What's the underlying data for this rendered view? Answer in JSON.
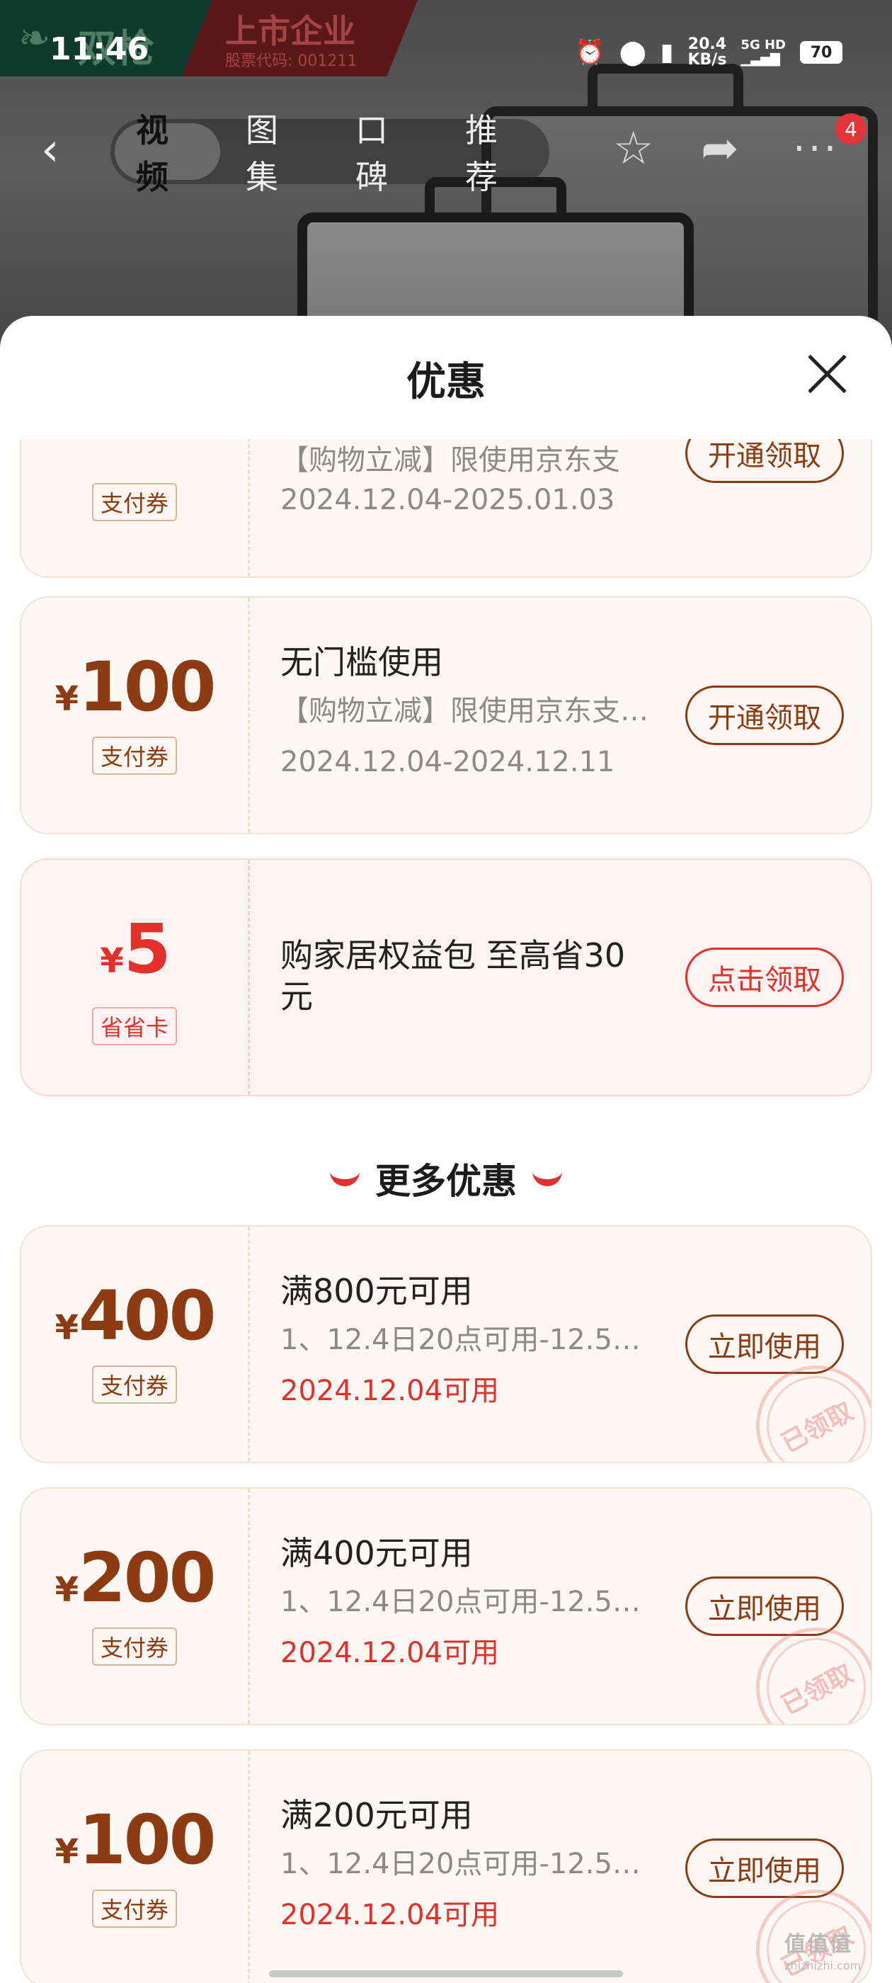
{
  "status_bar": {
    "time": "11:46",
    "speed_value": "20.4",
    "speed_unit": "KB/s",
    "network_type": "5G HD",
    "battery": "70"
  },
  "brand_banner": {
    "name": "双枪",
    "listed": "上市企业",
    "stock_code": "股票代码: 001211"
  },
  "nav": {
    "tabs": [
      {
        "label": "视频",
        "active": true
      },
      {
        "label": "图集",
        "active": false
      },
      {
        "label": "口碑",
        "active": false
      },
      {
        "label": "推荐",
        "active": false
      }
    ],
    "message_badge": "4"
  },
  "sheet": {
    "title": "优惠"
  },
  "coupons": [
    {
      "tag": "支付券",
      "desc": "【购物立减】限使用京东支",
      "date": "2024.12.04-2025.01.03",
      "button": "开通领取"
    },
    {
      "currency": "¥",
      "amount": "100",
      "tag": "支付券",
      "title": "无门槛使用",
      "desc": "【购物立减】限使用京东支…",
      "date": "2024.12.04-2024.12.11",
      "button": "开通领取"
    },
    {
      "currency": "¥",
      "amount": "5",
      "tag": "省省卡",
      "title_line1": "购家居权益包 至高省30",
      "title_line2": "元",
      "button": "点击领取"
    }
  ],
  "more_section": {
    "title": "更多优惠"
  },
  "more_coupons": [
    {
      "currency": "¥",
      "amount": "400",
      "tag": "支付券",
      "title": "满800元可用",
      "desc": "1、12.4日20点可用-12.5…",
      "date": "2024.12.04可用",
      "button": "立即使用",
      "stamp": "已领取"
    },
    {
      "currency": "¥",
      "amount": "200",
      "tag": "支付券",
      "title": "满400元可用",
      "desc": "1、12.4日20点可用-12.5…",
      "date": "2024.12.04可用",
      "button": "立即使用",
      "stamp": "已领取"
    },
    {
      "currency": "¥",
      "amount": "100",
      "tag": "支付券",
      "title": "满200元可用",
      "desc": "1、12.4日20点可用-12.5…",
      "date": "2024.12.04可用",
      "button": "立即使用",
      "stamp": "已领取"
    }
  ],
  "watermark": {
    "main": "值值值",
    "sub": "zhizhizhi.com"
  },
  "colors": {
    "accent_brown": "#8c3b13",
    "accent_red": "#e2302a",
    "card_bg": "#fdf8f3"
  }
}
